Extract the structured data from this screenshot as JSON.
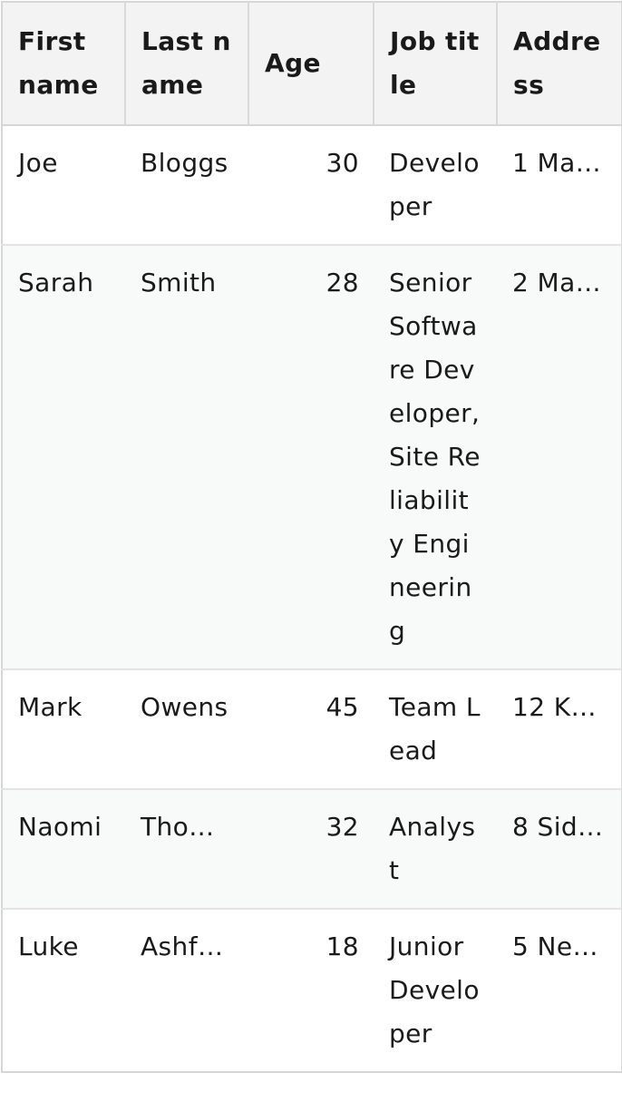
{
  "table": {
    "headers": [
      "First name",
      "Last name",
      "Age",
      "Job title",
      "Address"
    ],
    "rows": [
      {
        "first": "Joe",
        "last": "Bloggs",
        "age": "30",
        "job": "Developer",
        "address": "1 Ma…"
      },
      {
        "first": "Sarah",
        "last": "Smith",
        "age": "28",
        "job": "Senior Software Developer, Site Reliability Engineering",
        "address": "2 Ma…"
      },
      {
        "first": "Mark",
        "last": "Owens",
        "age": "45",
        "job": "Team Lead",
        "address": "12 K…"
      },
      {
        "first": "Naomi",
        "last": "Tho…",
        "age": "32",
        "job": "Analyst",
        "address": "8 Sid…"
      },
      {
        "first": "Luke",
        "last": "Ashf…",
        "age": "18",
        "job": "Junior Developer",
        "address": "5 Ne…"
      }
    ]
  }
}
